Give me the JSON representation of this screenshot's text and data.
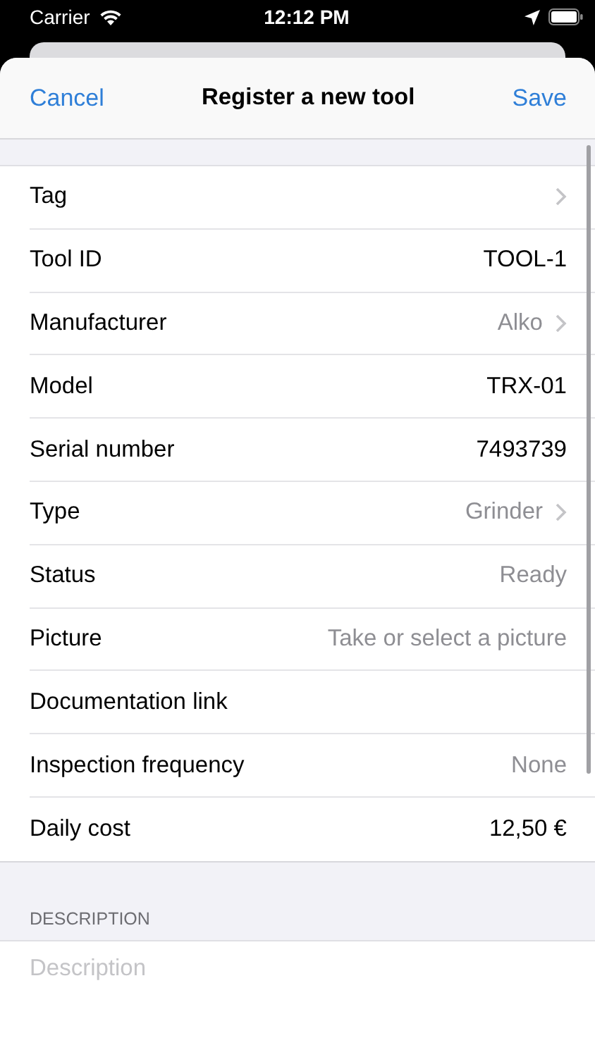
{
  "status_bar": {
    "carrier": "Carrier",
    "time": "12:12 PM"
  },
  "nav": {
    "cancel": "Cancel",
    "title": "Register a new tool",
    "save": "Save"
  },
  "rows": [
    {
      "label": "Tag",
      "chevron": true
    },
    {
      "label": "Tool ID",
      "value": "TOOL-1",
      "chevron": false,
      "dimmed": false
    },
    {
      "label": "Manufacturer",
      "value": "Alko",
      "chevron": true,
      "dimmed": true
    },
    {
      "label": "Model",
      "value": "TRX-01",
      "chevron": false,
      "dimmed": false
    },
    {
      "label": "Serial number",
      "value": "7493739",
      "chevron": false,
      "dimmed": false
    },
    {
      "label": "Type",
      "value": "Grinder",
      "chevron": true,
      "dimmed": true
    },
    {
      "label": "Status",
      "value": "Ready",
      "chevron": false,
      "dimmed": true
    },
    {
      "label": "Picture",
      "value": "Take or select a picture",
      "chevron": false,
      "dimmed": true
    },
    {
      "label": "Documentation link",
      "chevron": false
    },
    {
      "label": "Inspection frequency",
      "value": "None",
      "chevron": false,
      "dimmed": true
    },
    {
      "label": "Daily cost",
      "value": "12,50 €",
      "chevron": false,
      "dimmed": false
    }
  ],
  "description": {
    "header": "DESCRIPTION",
    "placeholder": "Description"
  }
}
